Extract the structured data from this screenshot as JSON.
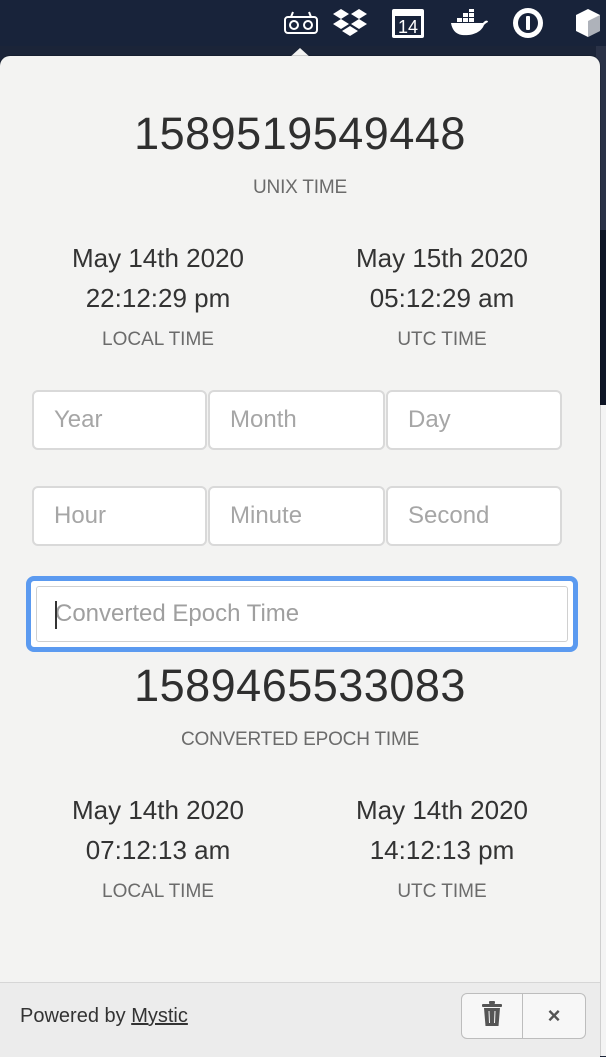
{
  "menubar": {
    "icons": [
      "recorder-icon",
      "dropbox-icon",
      "calendar-icon",
      "docker-icon",
      "1password-icon",
      "box-icon"
    ],
    "calendar_day": "14"
  },
  "current": {
    "unix_time": "1589519549448",
    "unix_label": "UNIX TIME",
    "local": {
      "date": "May 14th 2020",
      "time": "22:12:29 pm",
      "label": "LOCAL TIME"
    },
    "utc": {
      "date": "May 15th 2020",
      "time": "05:12:29 am",
      "label": "UTC TIME"
    }
  },
  "inputs": {
    "year_placeholder": "Year",
    "month_placeholder": "Month",
    "day_placeholder": "Day",
    "hour_placeholder": "Hour",
    "minute_placeholder": "Minute",
    "second_placeholder": "Second",
    "epoch_placeholder": "Converted Epoch Time"
  },
  "converted": {
    "epoch_time": "1589465533083",
    "epoch_label": "CONVERTED EPOCH TIME",
    "local": {
      "date": "May 14th 2020",
      "time": "07:12:13 am",
      "label": "LOCAL TIME"
    },
    "utc": {
      "date": "May 14th 2020",
      "time": "14:12:13 pm",
      "label": "UTC TIME"
    }
  },
  "footer": {
    "powered_text": "Powered by",
    "powered_link": "Mystic",
    "close_label": "×"
  }
}
